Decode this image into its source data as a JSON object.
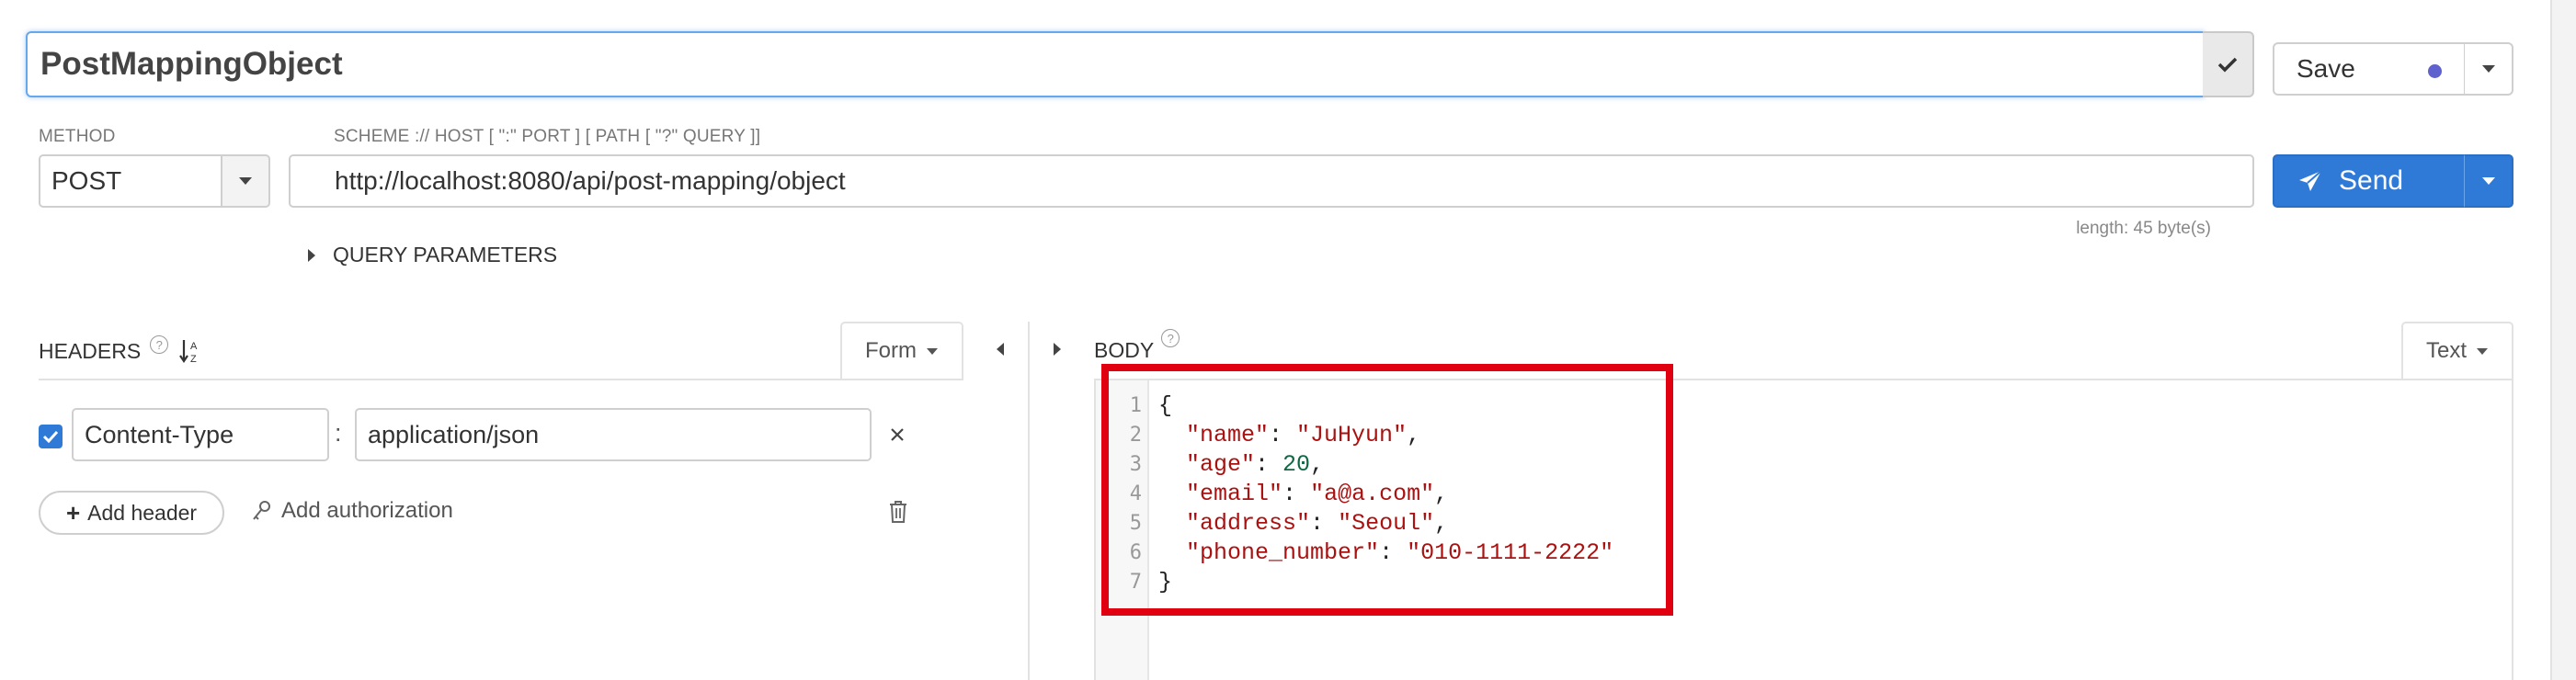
{
  "request": {
    "name": "PostMappingObject",
    "save_label": "Save",
    "method_label": "METHOD",
    "method": "POST",
    "url_label": "SCHEME :// HOST [ \":\" PORT ] [ PATH [ \"?\" QUERY ]]",
    "url": "http://localhost:8080/api/post-mapping/object",
    "send_label": "Send",
    "length_text": "length: 45 byte(s)",
    "query_params_label": "QUERY PARAMETERS"
  },
  "headers_pane": {
    "title": "HEADERS",
    "mode": "Form",
    "rows": [
      {
        "enabled": true,
        "key": "Content-Type",
        "value": "application/json"
      }
    ],
    "add_header_label": "Add header",
    "add_auth_label": "Add authorization"
  },
  "body_pane": {
    "title": "BODY",
    "mode": "Text",
    "line_numbers": [
      "1",
      "2",
      "3",
      "4",
      "5",
      "6",
      "7"
    ],
    "json_fields": {
      "name": "JuHyun",
      "age": 20,
      "email": "a@a.com",
      "address": "Seoul",
      "phone_number": "010-1111-2222"
    },
    "tokens": {
      "open": "{",
      "close": "}",
      "k_name": "\"name\"",
      "v_name": "\"JuHyun\"",
      "k_age": "\"age\"",
      "v_age": "20",
      "k_email": "\"email\"",
      "v_email": "\"a@a.com\"",
      "k_address": "\"address\"",
      "v_address": "\"Seoul\"",
      "k_phone": "\"phone_number\"",
      "v_phone": "\"010-1111-2222\""
    }
  },
  "colors": {
    "accent_blue": "#2f7ad6",
    "save_dot": "#5f61cf",
    "highlight_red": "#e0000f",
    "code_string": "#aa1111",
    "code_number": "#116644"
  },
  "icons": {
    "title_confirm": "check-icon",
    "save_menu": "chevron-down-icon",
    "send": "paper-plane-icon",
    "query_toggle": "triangle-right-icon",
    "headers_help": "question-circle-icon",
    "headers_sort": "sort-alpha-icon",
    "collapse_left": "triangle-left-icon",
    "expand_right": "triangle-right-icon",
    "remove_header": "close-icon",
    "add_auth": "key-icon",
    "delete_all": "trash-icon"
  }
}
